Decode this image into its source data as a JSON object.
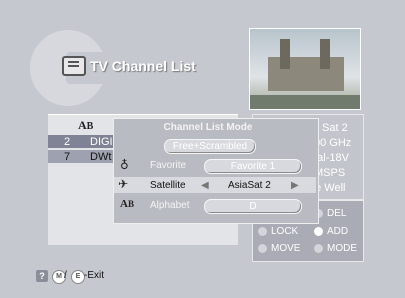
{
  "header": {
    "title": "TV Channel List"
  },
  "channels": {
    "header_icon": "alphabet-icon",
    "rows": [
      {
        "num": "2",
        "name": "DIGI"
      },
      {
        "num": "7",
        "name": "DWt"
      }
    ]
  },
  "info": {
    "lines": [
      "Sat 2",
      "00 GHz",
      "ntal-18V",
      "MSPS",
      "he Well"
    ]
  },
  "legend": {
    "del": "DEL",
    "lock": "LOCK",
    "add": "ADD",
    "move": "MOVE",
    "mode": "MODE"
  },
  "dialog": {
    "title": "Channel List Mode",
    "mode_value": "Free+Scrambled",
    "favorite_label": "Favorite",
    "favorite_value": "Favorite 1",
    "satellite_label": "Satellite",
    "satellite_value": "AsiaSat 2",
    "alphabet_label": "Alphabet",
    "alphabet_value": "D"
  },
  "footer": {
    "help": "?",
    "menu_key": "M",
    "exit_key": "E",
    "exit_text": "-Exit",
    "separator": "/"
  }
}
